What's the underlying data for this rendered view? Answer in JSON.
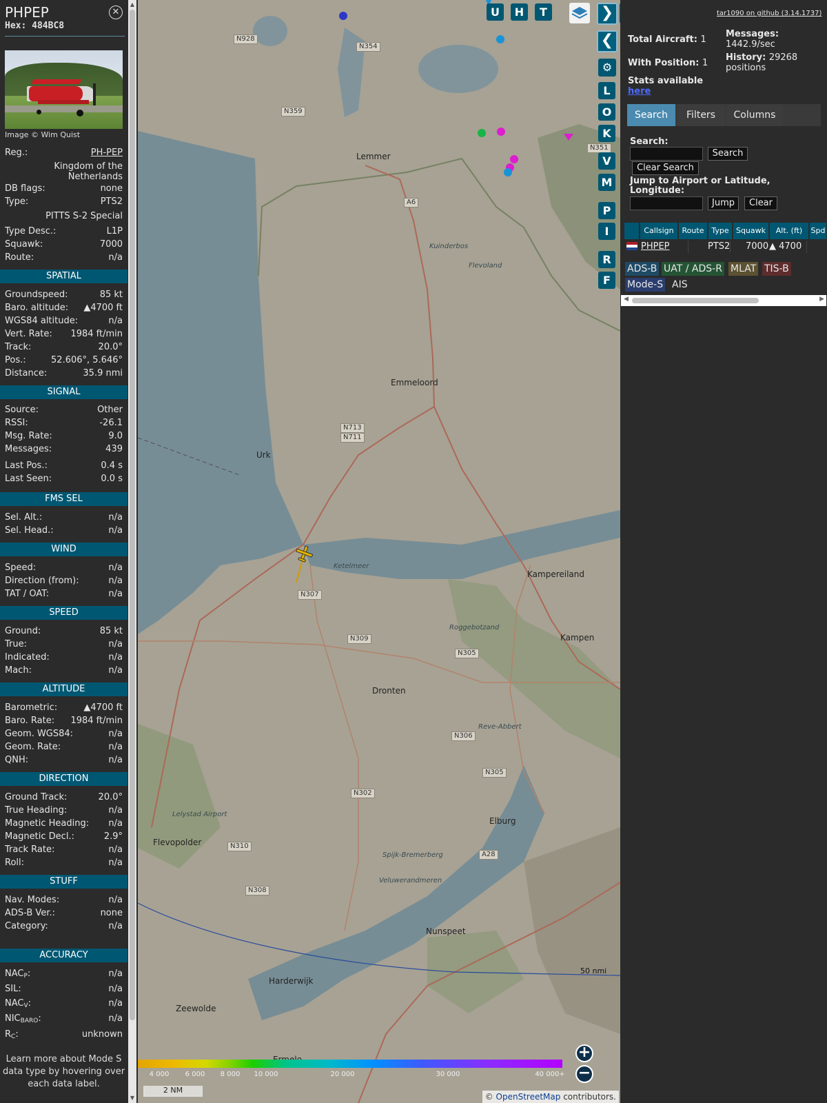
{
  "info": {
    "callsign": "PHPEP",
    "hex": "Hex: 484BC8",
    "photo_credit": "Image © Wim Quist",
    "reg_label": "Reg.:",
    "reg_value": "PH-PEP",
    "country": "Kingdom of the Netherlands",
    "dbflags_label": "DB flags:",
    "dbflags_value": "none",
    "type_label": "Type:",
    "type_value": "PTS2",
    "type_name": "PITTS S-2 Special",
    "typedesc_label": "Type Desc.:",
    "typedesc_value": "L1P",
    "squawk_label": "Squawk:",
    "squawk_value": "7000",
    "route_label": "Route:",
    "route_value": "n/a"
  },
  "sections": {
    "spatial": "SPATIAL",
    "signal": "SIGNAL",
    "fms": "FMS SEL",
    "wind": "WIND",
    "speed": "SPEED",
    "altitude": "ALTITUDE",
    "direction": "DIRECTION",
    "stuff": "STUFF",
    "accuracy": "ACCURACY"
  },
  "spatial": [
    {
      "k": "Groundspeed:",
      "v": "85 kt"
    },
    {
      "k": "Baro. altitude:",
      "v": "▲4700 ft"
    },
    {
      "k": "WGS84 altitude:",
      "v": "n/a"
    },
    {
      "k": "Vert. Rate:",
      "v": "1984 ft/min"
    },
    {
      "k": "Track:",
      "v": "20.0°"
    },
    {
      "k": "Pos.:",
      "v": "52.606°, 5.646°"
    },
    {
      "k": "Distance:",
      "v": "35.9 nmi"
    }
  ],
  "signal": [
    {
      "k": "Source:",
      "v": "Other"
    },
    {
      "k": "RSSI:",
      "v": "-26.1"
    },
    {
      "k": "Msg. Rate:",
      "v": "9.0"
    },
    {
      "k": "Messages:",
      "v": "439"
    },
    {
      "k": "Last Pos.:",
      "v": "0.4 s"
    },
    {
      "k": "Last Seen:",
      "v": "0.0 s"
    }
  ],
  "fms": [
    {
      "k": "Sel. Alt.:",
      "v": "n/a"
    },
    {
      "k": "Sel. Head.:",
      "v": "n/a"
    }
  ],
  "wind": [
    {
      "k": "Speed:",
      "v": "n/a"
    },
    {
      "k": "Direction (from):",
      "v": "n/a"
    },
    {
      "k": "TAT / OAT:",
      "v": "n/a"
    }
  ],
  "speed": [
    {
      "k": "Ground:",
      "v": "85 kt"
    },
    {
      "k": "True:",
      "v": "n/a"
    },
    {
      "k": "Indicated:",
      "v": "n/a"
    },
    {
      "k": "Mach:",
      "v": "n/a"
    }
  ],
  "altitude": [
    {
      "k": "Barometric:",
      "v": "▲4700 ft"
    },
    {
      "k": "Baro. Rate:",
      "v": "1984 ft/min"
    },
    {
      "k": "Geom. WGS84:",
      "v": "n/a"
    },
    {
      "k": "Geom. Rate:",
      "v": "n/a"
    },
    {
      "k": "QNH:",
      "v": "n/a"
    }
  ],
  "direction": [
    {
      "k": "Ground Track:",
      "v": "20.0°"
    },
    {
      "k": "True Heading:",
      "v": "n/a"
    },
    {
      "k": "Magnetic Heading:",
      "v": "n/a"
    },
    {
      "k": "Magnetic Decl.:",
      "v": "2.9°"
    },
    {
      "k": "Track Rate:",
      "v": "n/a"
    },
    {
      "k": "Roll:",
      "v": "n/a"
    }
  ],
  "stuff": [
    {
      "k": "Nav. Modes:",
      "v": "n/a"
    },
    {
      "k": "ADS-B Ver.:",
      "v": "none"
    },
    {
      "k": "Category:",
      "v": "n/a"
    }
  ],
  "accuracy": {
    "nacp": "NAC",
    "nacp_sub": "P",
    "nacp_v": "n/a",
    "sil": "SIL:",
    "sil_v": "n/a",
    "nacv": "NAC",
    "nacv_sub": "V",
    "nacv_v": "n/a",
    "nic": "NIC",
    "nic_sub": "BARO",
    "nic_v": "n/a",
    "rc": "R",
    "rc_sub": "C",
    "rc_v": "unknown"
  },
  "learn_more": "Learn more about Mode S data type by hovering over each data label.",
  "map": {
    "buttons": [
      "U",
      "H",
      "T"
    ],
    "side_buttons": [
      "L",
      "O",
      "K",
      "V",
      "M",
      "P",
      "I",
      "R",
      "F"
    ],
    "places": [
      {
        "name": "Emmeloord"
      },
      {
        "name": "Urk"
      },
      {
        "name": "Lemmer"
      },
      {
        "name": "Kampereiland"
      },
      {
        "name": "Kampen"
      },
      {
        "name": "Dronten"
      },
      {
        "name": "Elburg"
      },
      {
        "name": "Flevopolder"
      },
      {
        "name": "Harderwijk"
      },
      {
        "name": "Zeewolde"
      },
      {
        "name": "Nunspeet"
      },
      {
        "name": "Ermelo"
      },
      {
        "name": "Ketelmeer"
      },
      {
        "name": "Veluwerandmeren"
      },
      {
        "name": "Kuinderbos"
      },
      {
        "name": "Flevoland"
      },
      {
        "name": "Lelystad Airport"
      },
      {
        "name": "Reve-Abbert"
      },
      {
        "name": "Roggebotzand"
      },
      {
        "name": "Spijk-Bremerberg"
      }
    ],
    "roads": [
      "N928",
      "N354",
      "N359",
      "A6",
      "N351",
      "N713",
      "N711",
      "N307",
      "N309",
      "N305",
      "N306",
      "N302",
      "N305",
      "N310",
      "N308",
      "A28"
    ],
    "range_label": "50 nmi",
    "legend_labels": [
      "4 000",
      "6 000",
      "8 000",
      "10 000",
      "20 000",
      "30 000",
      "40 000+"
    ],
    "scale_label": "2 NM",
    "attribution_prefix": "© ",
    "attribution_link": "OpenStreetMap",
    "attribution_suffix": " contributors."
  },
  "sidebar": {
    "github": "tar1090 on github (3.14.1737)",
    "total_aircraft_label": "Total Aircraft:",
    "total_aircraft": "1",
    "with_position_label": "With Position:",
    "with_position": "1",
    "messages_label": "Messages:",
    "messages": "1442.9/sec",
    "history_label": "History:",
    "history": "29268 positions",
    "stats_label": "Stats available",
    "stats_link": "here",
    "tabs": [
      "Search",
      "Filters",
      "Columns"
    ],
    "search_label": "Search:",
    "search_button": "Search",
    "clear_search_button": "Clear Search",
    "jump_label": "Jump to Airport or Latitude, Longitude:",
    "jump_button": "Jump",
    "clear_button": "Clear",
    "columns": [
      "Callsign",
      "Route",
      "Type",
      "Squawk",
      "Alt. (ft)",
      "Spd"
    ],
    "row": {
      "callsign": "PHPEP",
      "route": "",
      "type": "PTS2",
      "squawk": "7000",
      "alt": "▲ 4700"
    },
    "sources": [
      {
        "label": "ADS-B",
        "color": "#1e4a66"
      },
      {
        "label": "UAT / ADS-R",
        "color": "#245434"
      },
      {
        "label": "MLAT",
        "color": "#5c5130"
      },
      {
        "label": "TIS-B",
        "color": "#5e2c2c"
      },
      {
        "label": "Mode-S",
        "color": "#2a3d6e"
      },
      {
        "label": "AIS",
        "color": "#2b2b2b"
      }
    ]
  }
}
